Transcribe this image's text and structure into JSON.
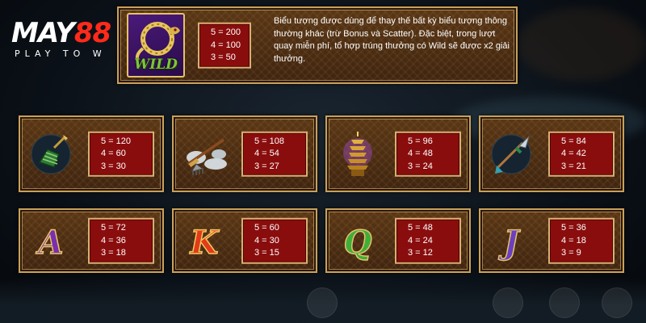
{
  "logo": {
    "brand_white": "MAY",
    "brand_red": "88",
    "tagline": "PLAY TO W"
  },
  "wild": {
    "payouts": [
      "5 = 200",
      "4 = 100",
      "3 = 50"
    ],
    "description": "Biểu tượng được dùng để thay thế bất kỳ biểu tượng thông thường khác (trừ Bonus và Scatter). Đặc biệt, trong lượt quay miễn phí, tổ hợp trúng thưởng có Wild sẽ được x2 giải thưởng.",
    "symbol_text": "WILD",
    "icon": "wild-snake-icon"
  },
  "symbols_row1": [
    {
      "icon": "green-gauntlet-icon",
      "payouts": [
        "5 = 120",
        "4 = 60",
        "3 = 30"
      ]
    },
    {
      "icon": "rake-weapon-icon",
      "payouts": [
        "5 = 108",
        "4 = 54",
        "3 = 27"
      ]
    },
    {
      "icon": "golden-pagoda-icon",
      "payouts": [
        "5 = 96",
        "4 = 48",
        "3 = 24"
      ]
    },
    {
      "icon": "spear-icon",
      "payouts": [
        "5 = 84",
        "4 = 42",
        "3 = 21"
      ]
    }
  ],
  "symbols_row2": [
    {
      "icon": "letter-a-icon",
      "glyph": "A",
      "payouts": [
        "5 = 72",
        "4 = 36",
        "3 = 18"
      ]
    },
    {
      "icon": "letter-k-icon",
      "glyph": "K",
      "payouts": [
        "5 = 60",
        "4 = 30",
        "3 = 15"
      ]
    },
    {
      "icon": "letter-q-icon",
      "glyph": "Q",
      "payouts": [
        "5 = 48",
        "4 = 24",
        "3 = 12"
      ]
    },
    {
      "icon": "letter-j-icon",
      "glyph": "J",
      "payouts": [
        "5 = 36",
        "4 = 18",
        "3 = 9"
      ]
    }
  ],
  "colors": {
    "panel_border": "#c9a15b",
    "paytable_bg": "#8a0d0d",
    "brand_red": "#ff2a1a"
  }
}
